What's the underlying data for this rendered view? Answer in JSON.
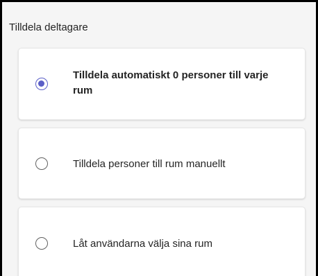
{
  "panel": {
    "title": "Tilldela deltagare"
  },
  "options": [
    {
      "label": "Tilldela automatiskt 0 personer till varje rum",
      "selected": true
    },
    {
      "label": "Tilldela personer till rum manuellt",
      "selected": false
    },
    {
      "label": "Låt användarna välja sina rum",
      "selected": false
    }
  ],
  "colors": {
    "accent": "#5b5fc7",
    "card_background": "#ffffff",
    "panel_background": "#f5f5f5",
    "text": "#242424"
  }
}
